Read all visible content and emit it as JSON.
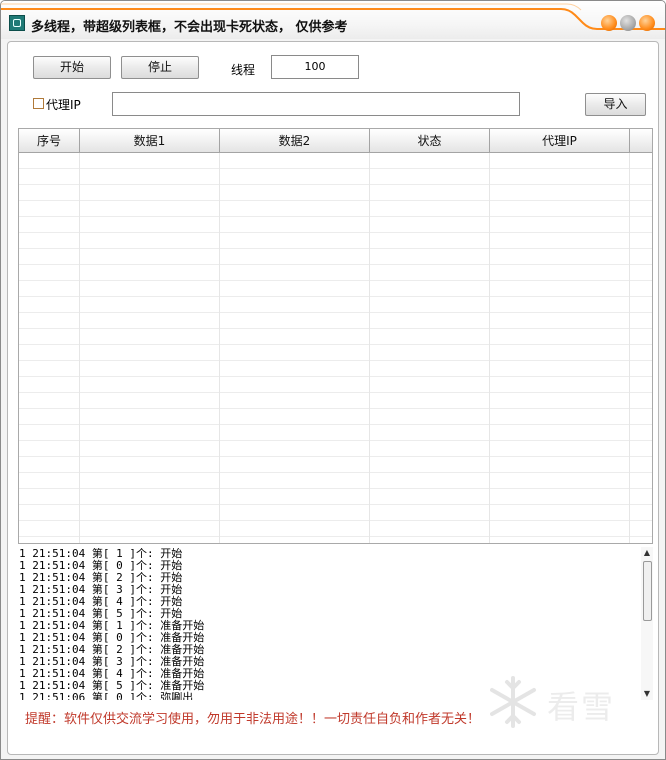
{
  "window": {
    "title": "多线程，带超级列表框，不会出现卡死状态， 仅供参考",
    "accent_color": "#ff8a18"
  },
  "toolbar": {
    "start_label": "开始",
    "stop_label": "停止",
    "thread_label": "线程",
    "thread_value": "100",
    "proxy_label": "代理IP",
    "proxy_checked": false,
    "proxy_value": "",
    "import_label": "导入"
  },
  "table": {
    "columns": [
      "序号",
      "数据1",
      "数据2",
      "状态",
      "代理IP"
    ],
    "rows": []
  },
  "log": {
    "lines": [
      "1 21:51:04 第[ 1 ]个: 开始",
      "1 21:51:04 第[ 0 ]个: 开始",
      "1 21:51:04 第[ 2 ]个: 开始",
      "1 21:51:04 第[ 3 ]个: 开始",
      "1 21:51:04 第[ 4 ]个: 开始",
      "1 21:51:04 第[ 5 ]个: 开始",
      "1 21:51:04 第[ 1 ]个: 准备开始",
      "1 21:51:04 第[ 0 ]个: 准备开始",
      "1 21:51:04 第[ 2 ]个: 准备开始",
      "1 21:51:04 第[ 3 ]个: 准备开始",
      "1 21:51:04 第[ 4 ]个: 准备开始",
      "1 21:51:04 第[ 5 ]个: 准备开始",
      "1 21:51:06 第[ 0 ]个: 弥唰出"
    ]
  },
  "warning": {
    "text": "提醒：软件仅供交流学习使用，勿用于非法用途！！一切责任自负和作者无关！",
    "color": "#c0392b"
  },
  "watermark": {
    "text": "看雪",
    "icon": "snowflake-icon"
  }
}
